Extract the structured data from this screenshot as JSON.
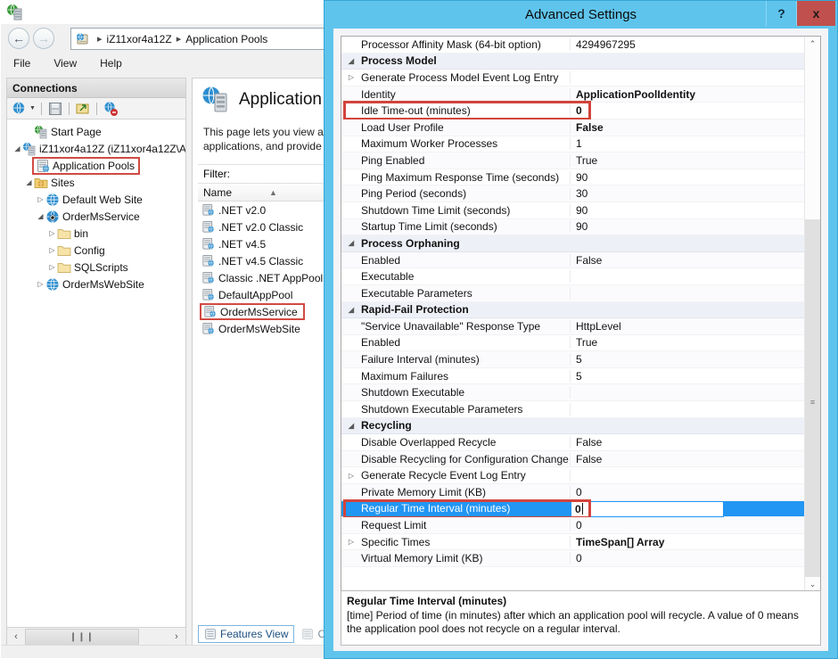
{
  "iis": {
    "window_icon": "iis-manager-icon",
    "nav": {
      "back": "←",
      "forward": "→"
    },
    "address": {
      "icon": "server-icon",
      "server": "iZ11xor4a12Z",
      "node": "Application Pools",
      "separator": "▸"
    },
    "menu": [
      "File",
      "View",
      "Help"
    ],
    "connections": {
      "header": "Connections",
      "toolbar_icons": [
        "connect-to-icon",
        "save-connections-icon",
        "export-connections-icon",
        "disconnect-icon"
      ],
      "tree": [
        {
          "label": "Start Page",
          "icon": "start-page-icon",
          "indent": 1,
          "expander": "",
          "highlight": false
        },
        {
          "label": "iZ11xor4a12Z (iZ11xor4a12Z\\A",
          "icon": "server-icon",
          "indent": 0,
          "expander": "◢",
          "highlight": false
        },
        {
          "label": "Application Pools",
          "icon": "app-pools-icon",
          "indent": 1,
          "expander": "",
          "highlight": true
        },
        {
          "label": "Sites",
          "icon": "sites-folder-icon",
          "indent": 1,
          "expander": "◢",
          "highlight": false
        },
        {
          "label": "Default Web Site",
          "icon": "web-site-icon",
          "indent": 2,
          "expander": "▷",
          "highlight": false
        },
        {
          "label": "OrderMsService",
          "icon": "web-app-icon",
          "indent": 2,
          "expander": "◢",
          "highlight": false
        },
        {
          "label": "bin",
          "icon": "folder-icon",
          "indent": 3,
          "expander": "▷",
          "highlight": false
        },
        {
          "label": "Config",
          "icon": "folder-icon",
          "indent": 3,
          "expander": "▷",
          "highlight": false
        },
        {
          "label": "SQLScripts",
          "icon": "folder-icon",
          "indent": 3,
          "expander": "▷",
          "highlight": false
        },
        {
          "label": "OrderMsWebSite",
          "icon": "web-site-icon",
          "indent": 2,
          "expander": "▷",
          "highlight": false
        }
      ]
    },
    "content": {
      "title": "Application",
      "description_line1": "This page lets you view ar",
      "description_line2": "applications, and provide",
      "filter_label": "Filter:",
      "column_header": "Name",
      "sort_indicator": "▲",
      "pools": [
        {
          "name": ".NET v2.0",
          "highlight": false
        },
        {
          "name": ".NET v2.0 Classic",
          "highlight": false
        },
        {
          "name": ".NET v4.5",
          "highlight": false
        },
        {
          "name": ".NET v4.5 Classic",
          "highlight": false
        },
        {
          "name": "Classic .NET AppPool",
          "highlight": false
        },
        {
          "name": "DefaultAppPool",
          "highlight": false
        },
        {
          "name": "OrderMsService",
          "highlight": true
        },
        {
          "name": "OrderMsWebSite",
          "highlight": false
        }
      ],
      "tabs": [
        {
          "label": "Features View",
          "icon": "features-view-icon",
          "active": true
        },
        {
          "label": "Cont",
          "icon": "content-view-icon",
          "active": false
        }
      ]
    },
    "hscroll": {
      "left": "‹",
      "right": "›",
      "grip": "❙❙❙"
    }
  },
  "dialog": {
    "title": "Advanced Settings",
    "help_button": "?",
    "close_button": "x",
    "scroll": {
      "up": "⌃",
      "down": "⌄",
      "grip": "≡"
    },
    "rows": [
      {
        "name": "Processor Affinity Mask (64-bit option)",
        "value": "4294967295",
        "type": "prop",
        "bold": false,
        "expander": ""
      },
      {
        "name": "Process Model",
        "value": "",
        "type": "category",
        "bold": true,
        "expander": "◢"
      },
      {
        "name": "Generate Process Model Event Log Entry",
        "value": "",
        "type": "prop",
        "bold": false,
        "expander": "▷"
      },
      {
        "name": "Identity",
        "value": "ApplicationPoolIdentity",
        "type": "prop",
        "bold": true,
        "expander": ""
      },
      {
        "name": "Idle Time-out (minutes)",
        "value": "0",
        "type": "prop",
        "bold": true,
        "expander": "",
        "redbox": true
      },
      {
        "name": "Load User Profile",
        "value": "False",
        "type": "prop",
        "bold": true,
        "expander": ""
      },
      {
        "name": "Maximum Worker Processes",
        "value": "1",
        "type": "prop",
        "bold": false,
        "expander": ""
      },
      {
        "name": "Ping Enabled",
        "value": "True",
        "type": "prop",
        "bold": false,
        "expander": ""
      },
      {
        "name": "Ping Maximum Response Time (seconds)",
        "value": "90",
        "type": "prop",
        "bold": false,
        "expander": ""
      },
      {
        "name": "Ping Period (seconds)",
        "value": "30",
        "type": "prop",
        "bold": false,
        "expander": ""
      },
      {
        "name": "Shutdown Time Limit (seconds)",
        "value": "90",
        "type": "prop",
        "bold": false,
        "expander": ""
      },
      {
        "name": "Startup Time Limit (seconds)",
        "value": "90",
        "type": "prop",
        "bold": false,
        "expander": ""
      },
      {
        "name": "Process Orphaning",
        "value": "",
        "type": "category",
        "bold": true,
        "expander": "◢"
      },
      {
        "name": "Enabled",
        "value": "False",
        "type": "prop",
        "bold": false,
        "expander": ""
      },
      {
        "name": "Executable",
        "value": "",
        "type": "prop",
        "bold": false,
        "expander": ""
      },
      {
        "name": "Executable Parameters",
        "value": "",
        "type": "prop",
        "bold": false,
        "expander": ""
      },
      {
        "name": "Rapid-Fail Protection",
        "value": "",
        "type": "category",
        "bold": true,
        "expander": "◢"
      },
      {
        "name": "\"Service Unavailable\" Response Type",
        "value": "HttpLevel",
        "type": "prop",
        "bold": false,
        "expander": ""
      },
      {
        "name": "Enabled",
        "value": "True",
        "type": "prop",
        "bold": false,
        "expander": ""
      },
      {
        "name": "Failure Interval (minutes)",
        "value": "5",
        "type": "prop",
        "bold": false,
        "expander": ""
      },
      {
        "name": "Maximum Failures",
        "value": "5",
        "type": "prop",
        "bold": false,
        "expander": ""
      },
      {
        "name": "Shutdown Executable",
        "value": "",
        "type": "prop",
        "bold": false,
        "expander": ""
      },
      {
        "name": "Shutdown Executable Parameters",
        "value": "",
        "type": "prop",
        "bold": false,
        "expander": ""
      },
      {
        "name": "Recycling",
        "value": "",
        "type": "category",
        "bold": true,
        "expander": "◢"
      },
      {
        "name": "Disable Overlapped Recycle",
        "value": "False",
        "type": "prop",
        "bold": false,
        "expander": ""
      },
      {
        "name": "Disable Recycling for Configuration Change",
        "value": "False",
        "type": "prop",
        "bold": false,
        "expander": ""
      },
      {
        "name": "Generate Recycle Event Log Entry",
        "value": "",
        "type": "prop",
        "bold": false,
        "expander": "▷"
      },
      {
        "name": "Private Memory Limit (KB)",
        "value": "0",
        "type": "prop",
        "bold": false,
        "expander": ""
      },
      {
        "name": "Regular Time Interval (minutes)",
        "value": "0",
        "type": "prop",
        "bold": true,
        "expander": "",
        "selected": true,
        "editing": true,
        "redbox": true
      },
      {
        "name": "Request Limit",
        "value": "0",
        "type": "prop",
        "bold": false,
        "expander": ""
      },
      {
        "name": "Specific Times",
        "value": "TimeSpan[] Array",
        "type": "prop",
        "bold": true,
        "expander": "▷"
      },
      {
        "name": "Virtual Memory Limit (KB)",
        "value": "0",
        "type": "prop",
        "bold": false,
        "expander": ""
      }
    ],
    "description": {
      "title": "Regular Time Interval (minutes)",
      "text": "[time] Period of time (in minutes) after which an application pool will recycle.  A value of 0 means the application pool does not recycle on a regular interval."
    }
  },
  "colors": {
    "dialog_accent": "#5fc4ec",
    "close_button": "#c0504d",
    "selection_blue": "#2196f3",
    "highlight_red": "#d2443c"
  }
}
